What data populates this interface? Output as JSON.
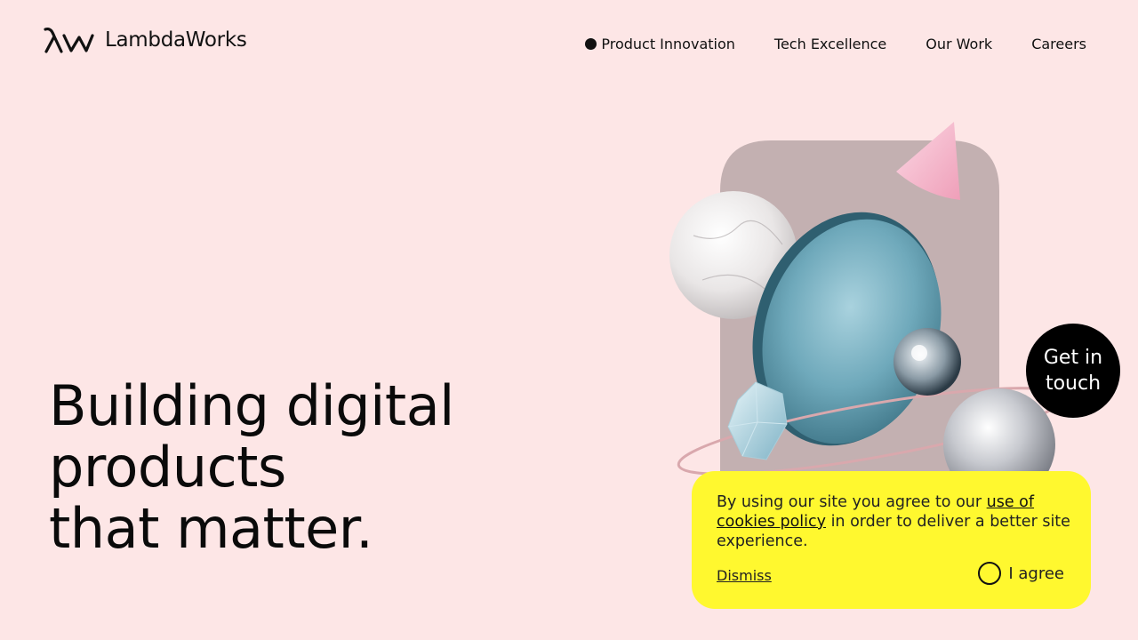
{
  "brand": {
    "name": "LambdaWorks",
    "background_color": "#fde6e6"
  },
  "nav": {
    "items": [
      {
        "label": "Product Innovation",
        "active": true
      },
      {
        "label": "Tech Excellence",
        "active": false
      },
      {
        "label": "Our Work",
        "active": false
      },
      {
        "label": "Careers",
        "active": false
      }
    ]
  },
  "hero": {
    "title_lines": [
      "Building digital",
      "products",
      "that matter."
    ]
  },
  "cta": {
    "line1": "Get in",
    "line2": "touch"
  },
  "cookie_banner": {
    "background_color": "#fff82f",
    "text_before": "By using our site you agree to our ",
    "link_text": "use of cookies policy",
    "text_after": " in order to deliver a better site experience.",
    "dismiss_label": "Dismiss",
    "agree_label": "I agree"
  }
}
